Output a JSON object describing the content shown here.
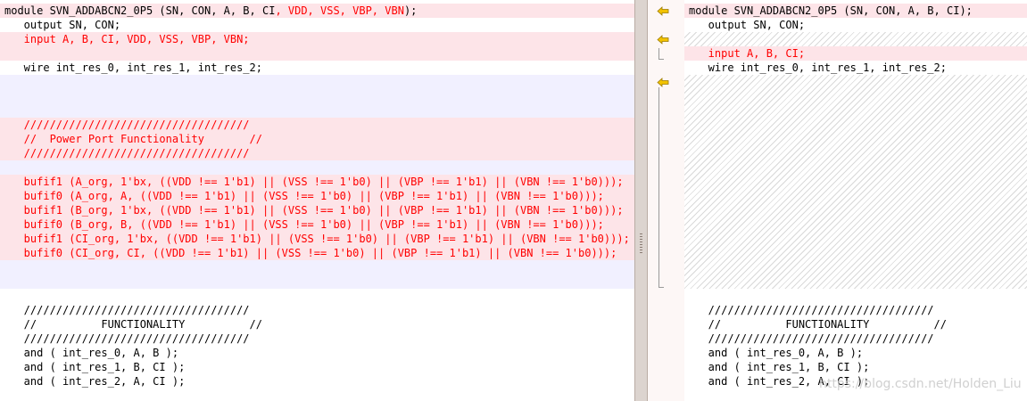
{
  "left": {
    "header_black": "module SVN_ADDABCN2_0P5 (SN, CON, A, B, CI",
    "header_red": ", VDD, VSS, VBP, VBN",
    "header_tail": ");",
    "output": "   output SN, CON;",
    "input": "   input A, B, CI, VDD, VSS, VBP, VBN;",
    "wire": "   wire int_res_0, int_res_1, int_res_2;",
    "pp_sep1": "   ///////////////////////////////////",
    "pp_title": "   //  Power Port Functionality       //",
    "pp_sep2": "   ///////////////////////////////////",
    "bufif_lines": [
      "   bufif1 (A_org, 1'bx, ((VDD !== 1'b1) || (VSS !== 1'b0) || (VBP !== 1'b1) || (VBN !== 1'b0)));",
      "   bufif0 (A_org, A, ((VDD !== 1'b1) || (VSS !== 1'b0) || (VBP !== 1'b1) || (VBN !== 1'b0)));",
      "   bufif1 (B_org, 1'bx, ((VDD !== 1'b1) || (VSS !== 1'b0) || (VBP !== 1'b1) || (VBN !== 1'b0)));",
      "   bufif0 (B_org, B, ((VDD !== 1'b1) || (VSS !== 1'b0) || (VBP !== 1'b1) || (VBN !== 1'b0)));",
      "   bufif1 (CI_org, 1'bx, ((VDD !== 1'b1) || (VSS !== 1'b0) || (VBP !== 1'b1) || (VBN !== 1'b0)));",
      "   bufif0 (CI_org, CI, ((VDD !== 1'b1) || (VSS !== 1'b0) || (VBP !== 1'b1) || (VBN !== 1'b0)));"
    ],
    "fn_sep1": "   ///////////////////////////////////",
    "fn_title": "   //          FUNCTIONALITY          //",
    "fn_sep2": "   ///////////////////////////////////",
    "and_lines": [
      "   and ( int_res_0, A, B );",
      "   and ( int_res_1, B, CI );",
      "   and ( int_res_2, A, CI );"
    ]
  },
  "right": {
    "header_black": "module SVN_ADDABCN2_0P5 (SN, CON, A, B, CI",
    "header_red": "",
    "header_tail": ");",
    "output": "   output SN, CON;",
    "input": "   input A, B, CI;",
    "wire": "   wire int_res_0, int_res_1, int_res_2;",
    "fn_sep1": "   ///////////////////////////////////",
    "fn_title": "   //          FUNCTIONALITY          //",
    "fn_sep2": "   ///////////////////////////////////",
    "and_lines": [
      "   and ( int_res_0, A, B );",
      "   and ( int_res_1, B, CI );",
      "   and ( int_res_2, A, CI );"
    ]
  },
  "gutter": {
    "arrow_icon": "merge-left-arrow-icon",
    "arrow_color": "#f2c200"
  },
  "watermark": "https://blog.csdn.net/Holden_Liu"
}
